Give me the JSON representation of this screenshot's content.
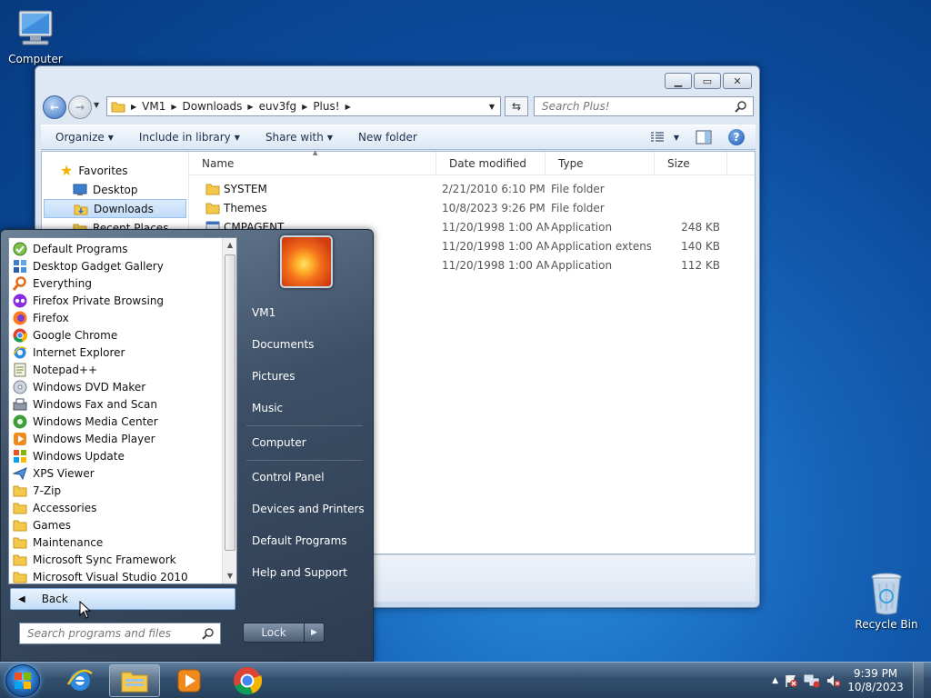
{
  "desktop": {
    "icons": [
      {
        "label": "Computer"
      },
      {
        "label": "Recycle Bin"
      }
    ]
  },
  "explorer": {
    "window_buttons": [
      "minimize",
      "restore",
      "close"
    ],
    "address": [
      "VM1",
      "Downloads",
      "euv3fg",
      "Plus!"
    ],
    "search_placeholder": "Search Plus!",
    "toolbar": {
      "organize": "Organize",
      "include_in_library": "Include in library",
      "share_with": "Share with",
      "new_folder": "New folder"
    },
    "nav_pane": {
      "favorites": "Favorites",
      "items": [
        "Desktop",
        "Downloads",
        "Recent Places"
      ]
    },
    "columns": {
      "name": "Name",
      "date_modified": "Date modified",
      "type": "Type",
      "size": "Size"
    },
    "files": [
      {
        "name": "SYSTEM",
        "date": "2/21/2010 6:10 PM",
        "type": "File folder",
        "size": ""
      },
      {
        "name": "Themes",
        "date": "10/8/2023 9:26 PM",
        "type": "File folder",
        "size": ""
      },
      {
        "name": "CMPAGENT",
        "date": "11/20/1998 1:00 AM",
        "type": "Application",
        "size": "248 KB"
      },
      {
        "name": "",
        "date": "11/20/1998 1:00 AM",
        "type": "Application extens...",
        "size": "140 KB"
      },
      {
        "name": "",
        "date": "11/20/1998 1:00 AM",
        "type": "Application",
        "size": "112 KB"
      }
    ]
  },
  "start_menu": {
    "programs": [
      {
        "label": "Default Programs",
        "icon": "default-programs-icon"
      },
      {
        "label": "Desktop Gadget Gallery",
        "icon": "gadget-icon"
      },
      {
        "label": "Everything",
        "icon": "everything-icon"
      },
      {
        "label": "Firefox Private Browsing",
        "icon": "firefox-private-icon"
      },
      {
        "label": "Firefox",
        "icon": "firefox-icon"
      },
      {
        "label": "Google Chrome",
        "icon": "chrome-icon"
      },
      {
        "label": "Internet Explorer",
        "icon": "ie-icon"
      },
      {
        "label": "Notepad++",
        "icon": "notepad-icon"
      },
      {
        "label": "Windows DVD Maker",
        "icon": "dvd-icon"
      },
      {
        "label": "Windows Fax and Scan",
        "icon": "fax-icon"
      },
      {
        "label": "Windows Media Center",
        "icon": "media-center-icon"
      },
      {
        "label": "Windows Media Player",
        "icon": "media-player-icon"
      },
      {
        "label": "Windows Update",
        "icon": "update-icon"
      },
      {
        "label": "XPS Viewer",
        "icon": "xps-icon"
      },
      {
        "label": "7-Zip",
        "icon": "folder-icon"
      },
      {
        "label": "Accessories",
        "icon": "folder-icon"
      },
      {
        "label": "Games",
        "icon": "folder-icon"
      },
      {
        "label": "Maintenance",
        "icon": "folder-icon"
      },
      {
        "label": "Microsoft Sync Framework",
        "icon": "folder-icon"
      },
      {
        "label": "Microsoft Visual Studio 2010",
        "icon": "folder-icon"
      }
    ],
    "back_label": "Back",
    "search_placeholder": "Search programs and files",
    "right_links": [
      "VM1",
      "Documents",
      "Pictures",
      "Music",
      "Computer",
      "Control Panel",
      "Devices and Printers",
      "Default Programs",
      "Help and Support"
    ],
    "lock_label": "Lock"
  },
  "taskbar": {
    "apps": [
      "internet-explorer",
      "windows-explorer",
      "media-player",
      "google-chrome"
    ],
    "time": "9:39 PM",
    "date": "10/8/2023"
  },
  "colors": {
    "accent": "#3b73c4",
    "desktop_blue": "#1663b8",
    "selection": "#c1dcf8"
  }
}
